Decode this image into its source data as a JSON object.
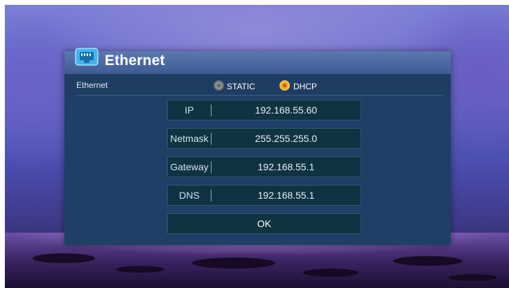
{
  "dialog": {
    "title": "Ethernet",
    "icon": "ethernet-port-icon",
    "mode_label": "Ethernet",
    "modes": [
      {
        "label": "STATIC",
        "selected": false
      },
      {
        "label": "DHCP",
        "selected": true
      }
    ],
    "fields": [
      {
        "label": "IP",
        "value": "192.168.55.60"
      },
      {
        "label": "Netmask",
        "value": "255.255.255.0"
      },
      {
        "label": "Gateway",
        "value": "192.168.55.1"
      },
      {
        "label": "DNS",
        "value": "192.168.55.1"
      }
    ],
    "ok_label": "OK"
  },
  "colors": {
    "accent": "#f0a91f",
    "dialog_bg": "#1f3f66",
    "header_bg": "#4a68a2",
    "field_bg": "#0f3341"
  }
}
